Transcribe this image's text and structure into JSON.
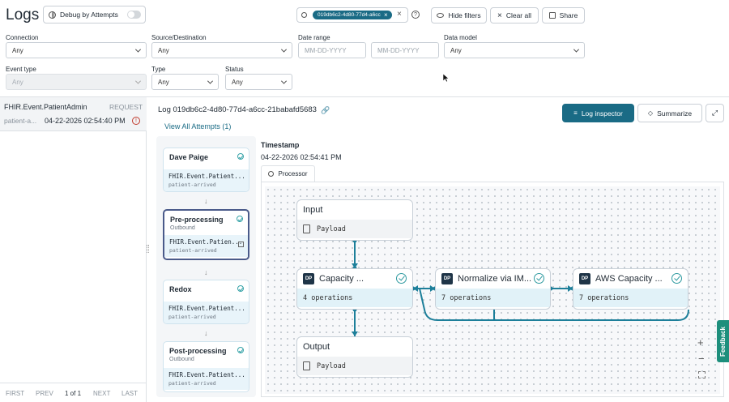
{
  "header": {
    "title": "Logs",
    "debug_label": "Debug by Attempts",
    "search_chip": "019db6c2-4d80-77d4-a6cc",
    "hide_filters": "Hide filters",
    "clear_all": "Clear all",
    "share": "Share"
  },
  "filters": {
    "connection": {
      "label": "Connection",
      "value": "Any"
    },
    "source_destination": {
      "label": "Source/Destination",
      "value": "Any"
    },
    "date_range": {
      "label": "Date range",
      "from_placeholder": "MM-DD-YYYY",
      "to_placeholder": "MM-DD-YYYY"
    },
    "data_model": {
      "label": "Data model",
      "value": "Any"
    },
    "event_type": {
      "label": "Event type",
      "value": "Any"
    },
    "type": {
      "label": "Type",
      "value": "Any"
    },
    "status": {
      "label": "Status",
      "value": "Any"
    }
  },
  "log_list": {
    "items": [
      {
        "event": "FHIR.Event.PatientAdmin",
        "kind": "REQUEST",
        "id": "patient-a...",
        "time": "04-22-2026 02:54:40 PM"
      }
    ],
    "pagination": {
      "first": "FIRST",
      "prev": "PREV",
      "page": "1 of 1",
      "next": "NEXT",
      "last": "LAST"
    }
  },
  "detail": {
    "log_title": "Log 019db6c2-4d80-77d4-a6cc-21babafd5683",
    "view_attempts": "View All Attempts (1)",
    "log_inspector": "Log inspector",
    "summarize": "Summarize",
    "timestamp_label": "Timestamp",
    "timestamp_value": "04-22-2026 02:54:41 PM",
    "tab": "Processor",
    "steps": [
      {
        "title": "Dave Paige",
        "sub": "",
        "event": "FHIR.Event.Patient...",
        "meta": "patient-arrived"
      },
      {
        "title": "Pre-processing",
        "sub": "Outbound",
        "event": "FHIR.Event.Patien...",
        "meta": "patient-arrived"
      },
      {
        "title": "Redox",
        "sub": "",
        "event": "FHIR.Event.Patient...",
        "meta": "patient-arrived"
      },
      {
        "title": "Post-processing",
        "sub": "Outbound",
        "event": "FHIR.Event.Patient...",
        "meta": "patient-arrived"
      }
    ],
    "canvas": {
      "input": {
        "title": "Input",
        "body": "Payload"
      },
      "output": {
        "title": "Output",
        "body": "Payload"
      },
      "processors": [
        {
          "badge": "DP",
          "title": "Capacity ...",
          "body": "4 operations"
        },
        {
          "badge": "DP",
          "title": "Normalize via IM...",
          "body": "7 operations"
        },
        {
          "badge": "DP",
          "title": "AWS Capacity ...",
          "body": "7 operations"
        }
      ],
      "zoom_in": "+",
      "zoom_out": "−"
    },
    "feedback": "Feedback"
  },
  "colors": {
    "primary": "#1a6b85",
    "flow_line": "#1d7f9a",
    "teal_check": "#2e9aa0",
    "feedback": "#1d8f7c"
  }
}
